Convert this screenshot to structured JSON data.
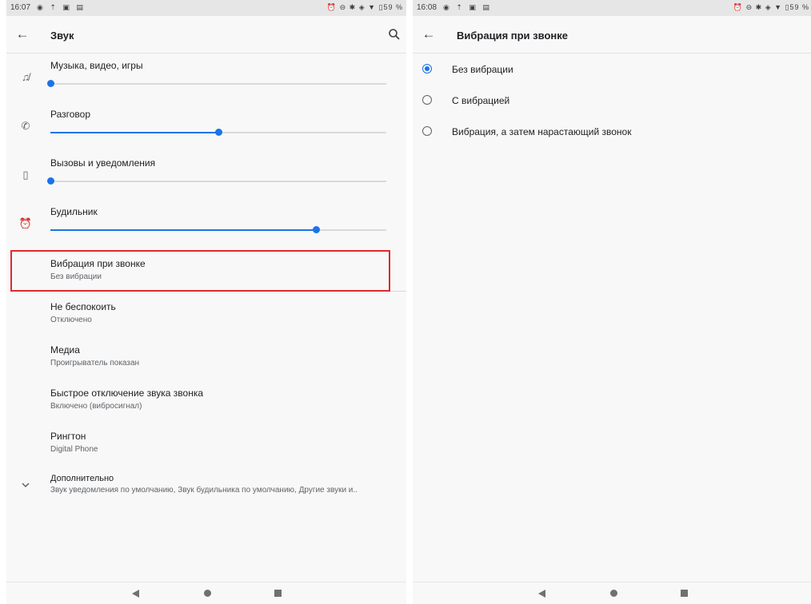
{
  "left": {
    "status": {
      "time": "16:07",
      "battery": "59 %"
    },
    "appbar": {
      "title": "Звук"
    },
    "volumes": [
      {
        "label": "Музыка, видео, игры",
        "icon": "music-off-icon",
        "level": 0.0
      },
      {
        "label": "Разговор",
        "icon": "phone-icon",
        "level": 0.5
      },
      {
        "label": "Вызовы и уведомления",
        "icon": "vibrate-icon",
        "level": 0.0
      },
      {
        "label": "Будильник",
        "icon": "alarm-icon",
        "level": 0.79
      }
    ],
    "prefs": [
      {
        "title": "Вибрация при звонке",
        "summary": "Без вибрации"
      },
      {
        "title": "Не беспокоить",
        "summary": "Отключено"
      },
      {
        "title": "Медиа",
        "summary": "Проигрыватель показан"
      },
      {
        "title": "Быстрое отключение звука звонка",
        "summary": "Включено (вибросигнал)"
      },
      {
        "title": "Рингтон",
        "summary": "Digital Phone"
      },
      {
        "title": "Дополнительно",
        "summary": "Звук уведомления по умолчанию, Звук будильника по умолчанию, Другие звуки и.."
      }
    ]
  },
  "right": {
    "status": {
      "time": "16:08",
      "battery": "59 %"
    },
    "appbar": {
      "title": "Вибрация при звонке"
    },
    "options": [
      {
        "label": "Без вибрации",
        "selected": true
      },
      {
        "label": "С вибрацией",
        "selected": false
      },
      {
        "label": "Вибрация, а затем нарастающий звонок",
        "selected": false
      }
    ]
  },
  "colors": {
    "accent": "#1a73e8",
    "highlight": "#e0292f"
  }
}
